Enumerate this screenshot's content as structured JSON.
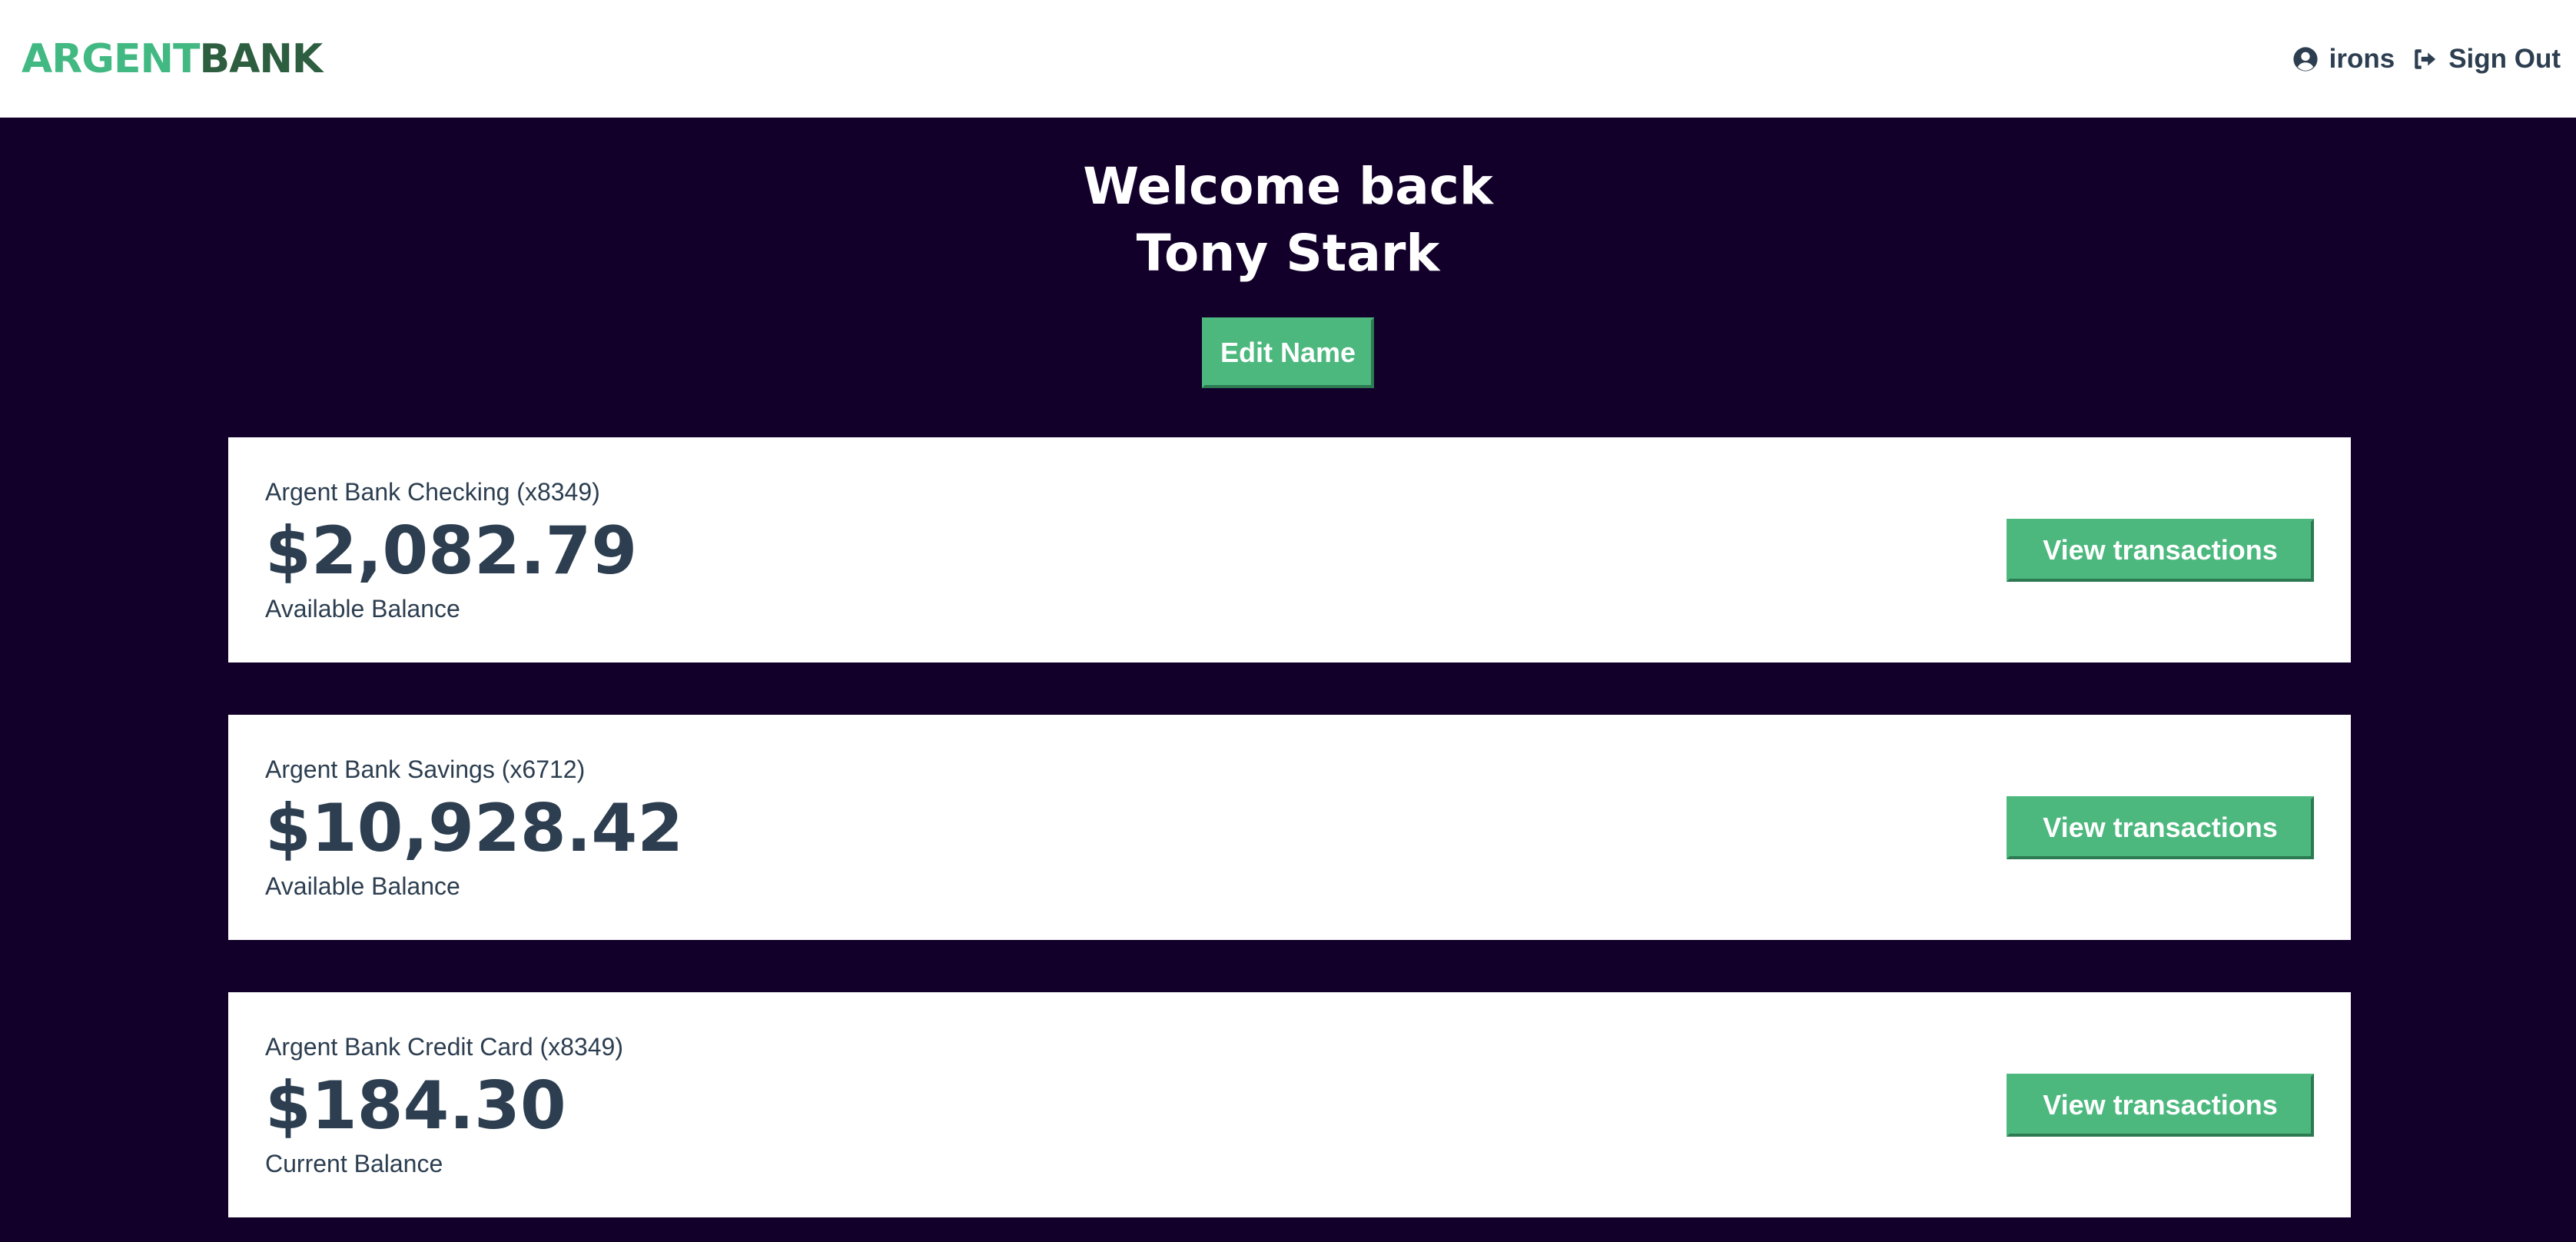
{
  "app": {
    "brand_part1": "ARGENT",
    "brand_part2": "BANK"
  },
  "nav": {
    "username": "irons",
    "signout_label": "Sign Out"
  },
  "header": {
    "greeting": "Welcome back",
    "name": "Tony Stark",
    "edit_label": "Edit Name"
  },
  "accounts": [
    {
      "title": "Argent Bank Checking (x8349)",
      "amount": "$2,082.79",
      "description": "Available Balance",
      "button_label": "View transactions"
    },
    {
      "title": "Argent Bank Savings (x6712)",
      "amount": "$10,928.42",
      "description": "Available Balance",
      "button_label": "View transactions"
    },
    {
      "title": "Argent Bank Credit Card (x8349)",
      "amount": "$184.30",
      "description": "Current Balance",
      "button_label": "View transactions"
    }
  ],
  "colors": {
    "accent": "#4cb87e",
    "brand_dark": "#2c5e3f",
    "background": "#12002b",
    "text": "#2c3e50"
  },
  "icons": {
    "user": "user-circle-icon",
    "signout": "sign-out-icon"
  }
}
